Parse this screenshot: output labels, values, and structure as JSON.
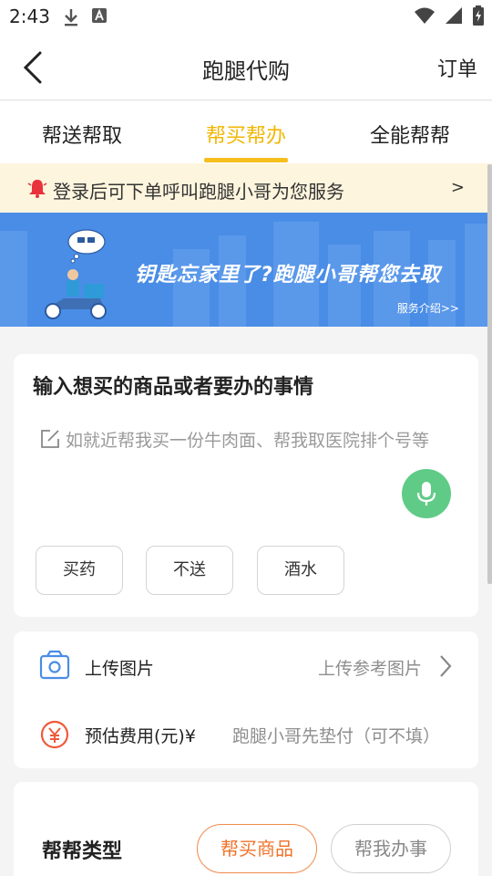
{
  "status_bar": {
    "time": "2:43",
    "left_icons": [
      "download-icon",
      "font-a-icon"
    ],
    "right_icons": [
      "wifi-icon",
      "signal-icon",
      "battery-charging-icon"
    ]
  },
  "nav": {
    "title": "跑腿代购",
    "order_label": "订单"
  },
  "tabs": [
    {
      "label": "帮送帮取",
      "active": false
    },
    {
      "label": "帮买帮办",
      "active": true
    },
    {
      "label": "全能帮帮",
      "active": false
    }
  ],
  "notice": {
    "text": "登录后可下单呼叫跑腿小哥为您服务",
    "arrow": ">"
  },
  "banner": {
    "title": "钥匙忘家里了?跑腿小哥帮您去取",
    "link": "服务介绍>>"
  },
  "request_card": {
    "title": "输入想买的商品或者要办的事情",
    "placeholder": "如就近帮我买一份牛肉面、帮我取医院排个号等",
    "chips": [
      "买药",
      "不送",
      "酒水"
    ]
  },
  "details_card": {
    "upload_label": "上传图片",
    "upload_value": "上传参考图片",
    "fee_label": "预估费用(元)¥",
    "fee_placeholder": "跑腿小哥先垫付（可不填）"
  },
  "type_card": {
    "title": "帮帮类型",
    "options": [
      {
        "label": "帮买商品",
        "active": true
      },
      {
        "label": "帮我办事",
        "active": false
      }
    ]
  },
  "colors": {
    "accent_yellow": "#f5be1d",
    "banner_blue": "#4a8de6",
    "mic_green": "#5fcb87",
    "active_orange": "#f0732a",
    "icon_blue": "#4a8de6",
    "icon_red": "#ef5a3c"
  }
}
